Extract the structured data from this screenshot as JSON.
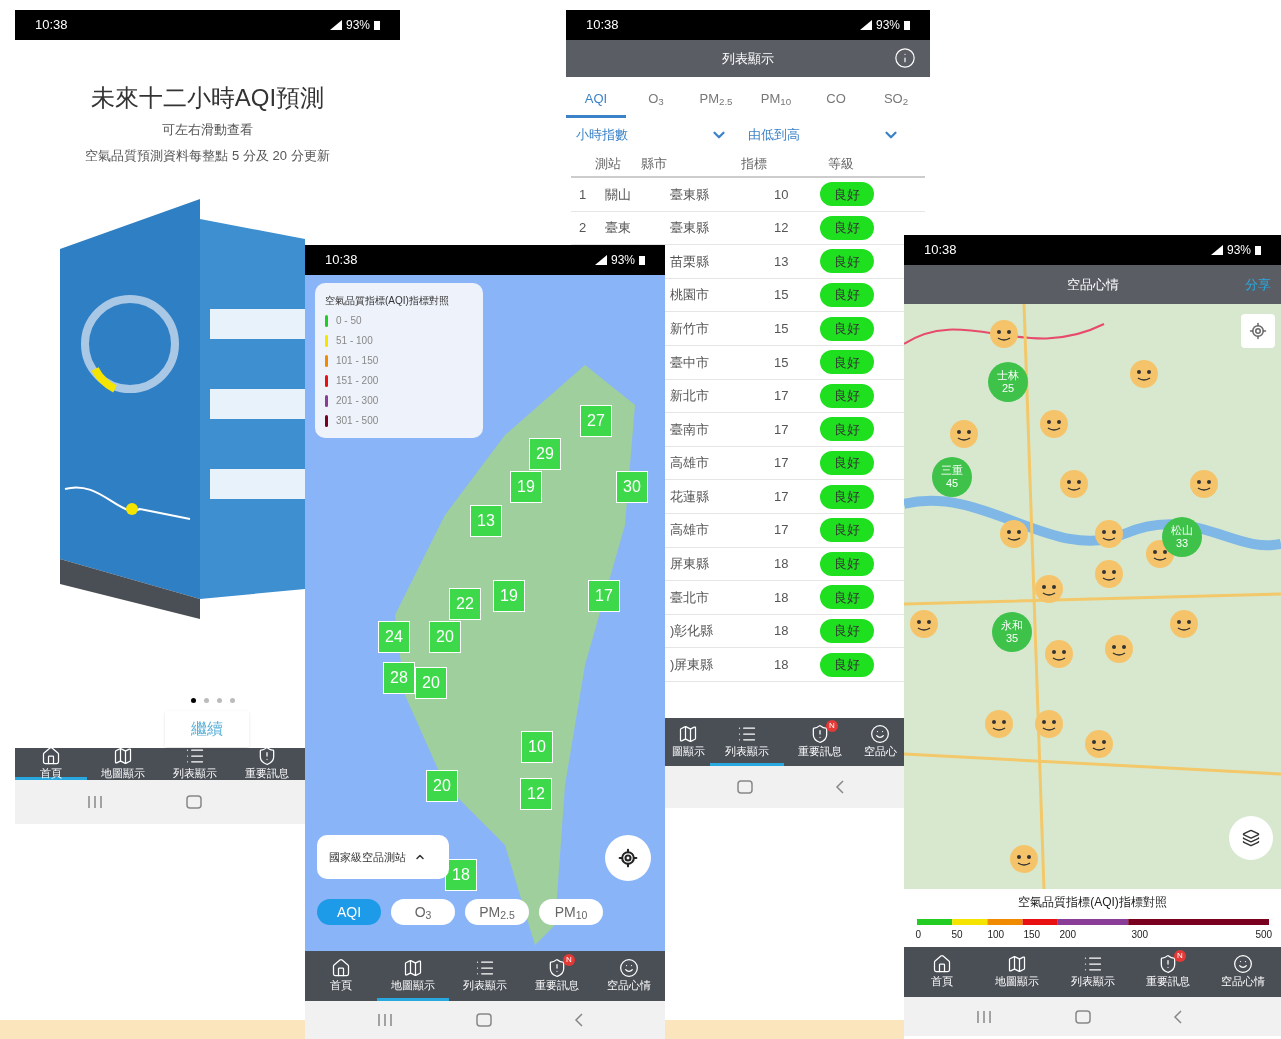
{
  "intro_screen": {
    "status_time": "10:38",
    "battery": "93%",
    "title": "未來十二小時AQI預測",
    "subtitle": "可左右滑動查看",
    "note": "空氣品質預測資料每整點 5 分及 20 分更新",
    "pages": [
      {
        "selected": true
      },
      {
        "selected": false
      },
      {
        "selected": false
      },
      {
        "selected": false
      }
    ],
    "continue_button": "繼續",
    "nav": [
      {
        "kind": "home",
        "label": "首頁",
        "selected": true
      },
      {
        "kind": "map",
        "label": "地圖顯示",
        "selected": false
      },
      {
        "kind": "list",
        "label": "列表顯示",
        "selected": false
      },
      {
        "kind": "alert",
        "label": "重要訊息",
        "selected": false
      }
    ]
  },
  "list_screen": {
    "status_time": "10:38",
    "battery": "93%",
    "title": "列表顯示",
    "tabs": [
      {
        "label": "AQI",
        "selected": true
      },
      {
        "label": "O$_{3}$",
        "selected": false
      },
      {
        "label": "PM$_{2.5}$",
        "selected": false
      },
      {
        "label": "PM$_{10}$",
        "selected": false
      },
      {
        "label": "CO",
        "selected": false
      },
      {
        "label": "SO$_{2}$",
        "selected": false
      }
    ],
    "filters": [
      "小時指數",
      "由低到高"
    ],
    "columns": [
      "測站",
      "縣市",
      "指標",
      "等級"
    ],
    "rows": [
      {
        "rank": "1",
        "station": "關山",
        "county": "臺東縣",
        "value": "10",
        "grade": "良好"
      },
      {
        "rank": "2",
        "station": "臺東",
        "county": "臺東縣",
        "value": "12",
        "grade": "良好"
      },
      {
        "county": "苗栗縣",
        "value": "13",
        "grade": "良好"
      },
      {
        "county": "桃園市",
        "value": "15",
        "grade": "良好"
      },
      {
        "county": "新竹市",
        "value": "15",
        "grade": "良好"
      },
      {
        "county": "臺中市",
        "value": "15",
        "grade": "良好"
      },
      {
        "county": "新北市",
        "value": "17",
        "grade": "良好"
      },
      {
        "county": "臺南市",
        "value": "17",
        "grade": "良好"
      },
      {
        "county": "高雄市",
        "value": "17",
        "grade": "良好"
      },
      {
        "county": "花蓮縣",
        "value": "17",
        "grade": "良好"
      },
      {
        "county": "高雄市",
        "value": "17",
        "grade": "良好"
      },
      {
        "county": "屏東縣",
        "value": "18",
        "grade": "良好"
      },
      {
        "county": "臺北市",
        "value": "18",
        "grade": "良好"
      },
      {
        "county": ")彰化縣",
        "value": "18",
        "grade": "良好"
      },
      {
        "county": ")屏東縣",
        "value": "18",
        "grade": "良好"
      }
    ],
    "nav": [
      {
        "kind": "map",
        "label": "圖顯示",
        "selected": false
      },
      {
        "kind": "list",
        "label": "列表顯示",
        "selected": true
      },
      {
        "kind": "alert",
        "label": "重要訊息",
        "selected": false,
        "badge": "N"
      },
      {
        "kind": "smile",
        "label": "空品心",
        "selected": false
      }
    ]
  },
  "map_screen": {
    "status_time": "10:38",
    "battery": "93%",
    "legend": {
      "title": "空氣品質指標(AQI)指標對照",
      "levels": [
        {
          "range": "0 - 50",
          "color": "#22cc22"
        },
        {
          "range": "51 - 100",
          "color": "#f5e400"
        },
        {
          "range": "101 - 150",
          "color": "#f08a00"
        },
        {
          "range": "151 - 200",
          "color": "#e81010"
        },
        {
          "range": "201 - 300",
          "color": "#8a3d96"
        },
        {
          "range": "301 - 500",
          "color": "#7a0020"
        }
      ]
    },
    "markers": [
      "27",
      "29",
      "19",
      "30",
      "13",
      "22",
      "19",
      "17",
      "24",
      "20",
      "28",
      "20",
      "10",
      "20",
      "12",
      "18"
    ],
    "station_selector": "國家級空品測站",
    "pollutants": [
      {
        "label": "AQI",
        "selected": true
      },
      {
        "label": "O$_{3}$",
        "selected": false
      },
      {
        "label": "PM$_{2.5}$",
        "selected": false
      },
      {
        "label": "PM$_{10}$",
        "selected": false
      }
    ],
    "nav": [
      {
        "kind": "home",
        "label": "首頁",
        "selected": false
      },
      {
        "kind": "map",
        "label": "地圖顯示",
        "selected": true
      },
      {
        "kind": "list",
        "label": "列表顯示",
        "selected": false
      },
      {
        "kind": "alert",
        "label": "重要訊息",
        "selected": false,
        "badge": "N"
      },
      {
        "kind": "smile",
        "label": "空品心情",
        "selected": false
      }
    ]
  },
  "mood_screen": {
    "status_time": "10:38",
    "battery": "93%",
    "title": "空品心情",
    "share": "分享",
    "stations": [
      {
        "name": "士林",
        "value": "25"
      },
      {
        "name": "三重",
        "value": "45"
      },
      {
        "name": "松山",
        "value": "33"
      },
      {
        "name": "永和",
        "value": "35"
      }
    ],
    "legend": {
      "title": "空氣品質指標(AQI)指標對照",
      "ticks": [
        "0",
        "50",
        "100",
        "150",
        "200",
        "300",
        "500"
      ]
    },
    "nav": [
      {
        "kind": "home",
        "label": "首頁",
        "selected": false
      },
      {
        "kind": "map",
        "label": "地圖顯示",
        "selected": false
      },
      {
        "kind": "list",
        "label": "列表顯示",
        "selected": false
      },
      {
        "kind": "alert",
        "label": "重要訊息",
        "selected": false,
        "badge": "N"
      },
      {
        "kind": "smile",
        "label": "空品心情",
        "selected": false
      }
    ]
  }
}
